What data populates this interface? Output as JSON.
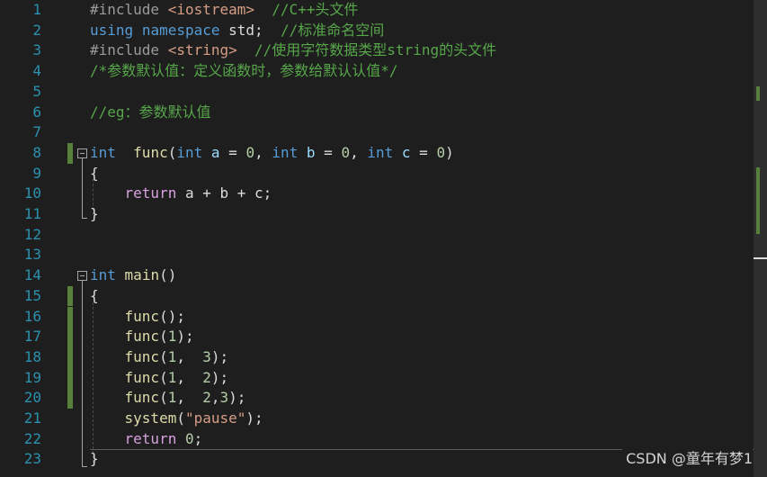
{
  "line_numbers": [
    "1",
    "2",
    "3",
    "4",
    "5",
    "6",
    "7",
    "8",
    "9",
    "10",
    "11",
    "12",
    "13",
    "14",
    "15",
    "16",
    "17",
    "18",
    "19",
    "20",
    "21",
    "22",
    "23"
  ],
  "code": {
    "l1": {
      "directive": "#include",
      "header": "<iostream>",
      "comment": "//C++头文件"
    },
    "l2": {
      "kw_using": "using",
      "kw_namespace": "namespace",
      "name": "std;",
      "comment": "//标准命名空间"
    },
    "l3": {
      "directive": "#include",
      "header": "<string>",
      "comment": "//使用字符数据类型string的头文件"
    },
    "l4": {
      "comment": "/*参数默认值：定义函数时，参数给默认认值*/"
    },
    "l6": {
      "comment": "//eg：参数默认值"
    },
    "l8": {
      "t1": "int",
      "fname": "func",
      "p1": "(",
      "t2": "int",
      "a": "a",
      "eq1": " = ",
      "n1": "0",
      "c1": ", ",
      "t3": "int",
      "b": "b",
      "eq2": " = ",
      "n2": "0",
      "c2": ", ",
      "t4": "int",
      "c": "c",
      "eq3": " = ",
      "n3": "0",
      "p2": ")"
    },
    "l9": {
      "text": "{"
    },
    "l10": {
      "kw": "return",
      "expr": "a + b + c;"
    },
    "l11": {
      "text": "}"
    },
    "l14": {
      "type": "int",
      "fname": "main",
      "rest": "()"
    },
    "l15": {
      "text": "{"
    },
    "l16": {
      "fname": "func",
      "args": "();"
    },
    "l17": {
      "fname": "func",
      "open": "(",
      "n1": "1",
      "close": ");"
    },
    "l18": {
      "fname": "func",
      "open": "(",
      "n1": "1",
      "sep": ",  ",
      "n2": "3",
      "close": ");"
    },
    "l19": {
      "fname": "func",
      "open": "(",
      "n1": "1",
      "sep": ",  ",
      "n2": "2",
      "close": ");"
    },
    "l20": {
      "fname": "func",
      "open": "(",
      "n1": "1",
      "sep": ",  ",
      "n2": "2",
      "sep2": ",",
      "n3": "3",
      "close": ");"
    },
    "l21": {
      "fname": "system",
      "open": "(",
      "str": "\"pause\"",
      "close": ");"
    },
    "l22": {
      "kw": "return",
      "num": "0",
      "semi": ";"
    },
    "l23": {
      "text": "}"
    }
  },
  "watermark": "CSDN @童年有梦1",
  "colors": {
    "background": "#1e1e1e",
    "line_number": "#2b91af",
    "keyword": "#569cd6",
    "control_keyword": "#d8a0df",
    "comment": "#57a64a",
    "string": "#d69d85",
    "function": "#dcdcaa",
    "number": "#b5cea8",
    "change_marker": "#57803a"
  }
}
